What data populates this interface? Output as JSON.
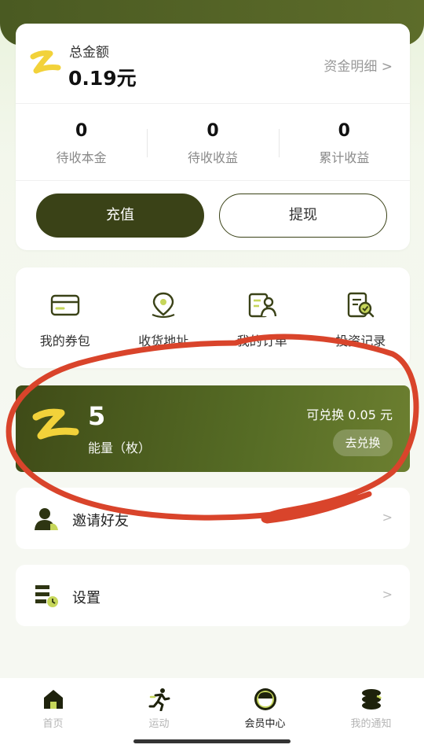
{
  "balance": {
    "label": "总金额",
    "amount": "0.19元",
    "detail_link": "资金明细 >",
    "stats": [
      {
        "value": "0",
        "label": "待收本金"
      },
      {
        "value": "0",
        "label": "待收收益"
      },
      {
        "value": "0",
        "label": "累计收益"
      }
    ],
    "recharge_label": "充值",
    "withdraw_label": "提现"
  },
  "quick_menu": [
    {
      "label": "我的券包",
      "icon": "wallet-card-icon"
    },
    {
      "label": "收货地址",
      "icon": "location-pin-icon"
    },
    {
      "label": "我的订单",
      "icon": "order-person-icon"
    },
    {
      "label": "投资记录",
      "icon": "document-search-icon"
    }
  ],
  "energy": {
    "value": "5",
    "label": "能量（枚）",
    "exchange_text": "可兑换 0.05 元",
    "exchange_button": "去兑换"
  },
  "list_items": [
    {
      "label": "邀请好友",
      "arrow": ">",
      "icon": "person-icon"
    },
    {
      "label": "设置",
      "arrow": ">",
      "icon": "settings-list-icon"
    }
  ],
  "tabbar": [
    {
      "label": "首页",
      "icon": "home-icon",
      "active": false
    },
    {
      "label": "运动",
      "icon": "running-icon",
      "active": false
    },
    {
      "label": "会员中心",
      "icon": "member-icon",
      "active": true
    },
    {
      "label": "我的通知",
      "icon": "stack-icon",
      "active": false
    }
  ],
  "colors": {
    "brand_dark": "#3a4217",
    "brand_green": "#566c25",
    "logo_yellow": "#f2d23a",
    "annotation_red": "#d9442b"
  }
}
